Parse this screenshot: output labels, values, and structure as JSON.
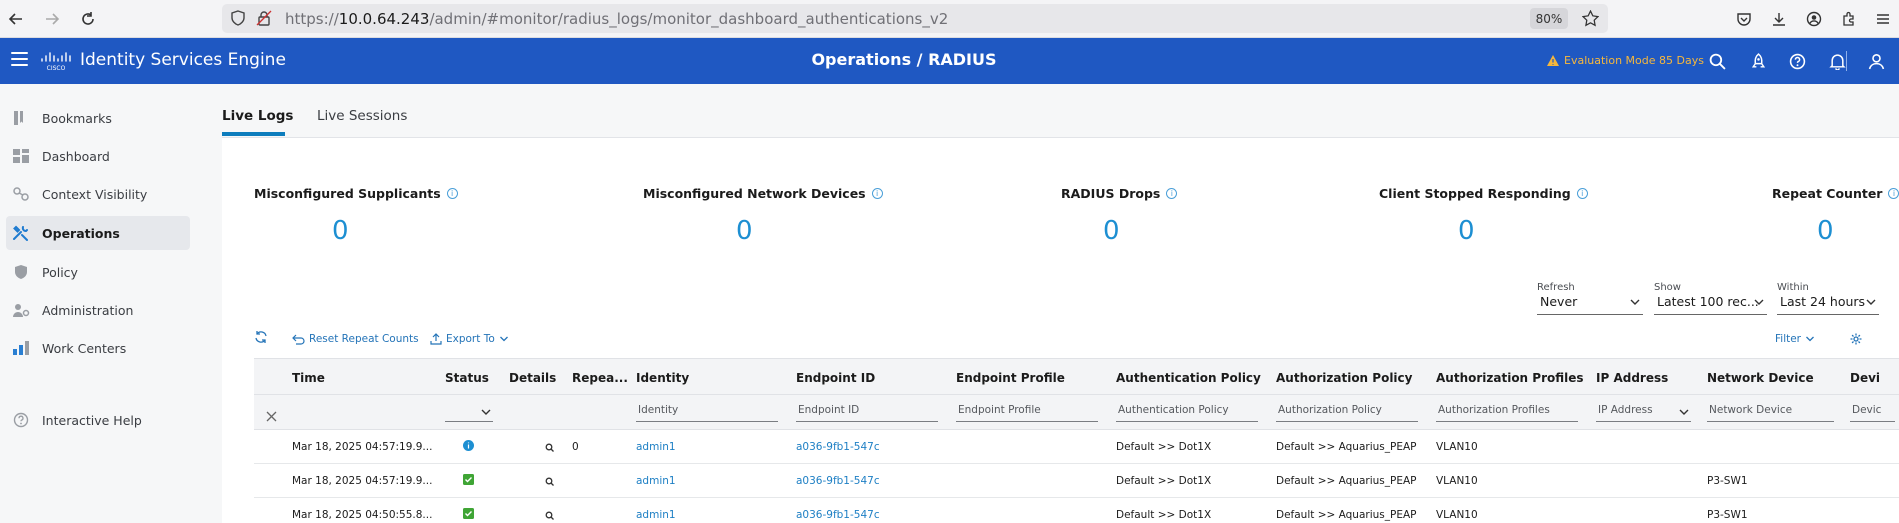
{
  "browser": {
    "url_prefix": "https://",
    "url_host": "10.0.64.243",
    "url_path": "/admin/#monitor/radius_logs/monitor_dashboard_authentications_v2",
    "zoom": "80%"
  },
  "header": {
    "app_title": "Identity Services Engine",
    "page_title": "Operations / RADIUS",
    "eval_mode": "Evaluation Mode 85 Days"
  },
  "sidebar": {
    "items": [
      {
        "label": "Bookmarks"
      },
      {
        "label": "Dashboard"
      },
      {
        "label": "Context Visibility"
      },
      {
        "label": "Operations"
      },
      {
        "label": "Policy"
      },
      {
        "label": "Administration"
      },
      {
        "label": "Work Centers"
      },
      {
        "label": "Interactive Help"
      }
    ]
  },
  "tabs": [
    {
      "label": "Live Logs"
    },
    {
      "label": "Live Sessions"
    }
  ],
  "kpis": [
    {
      "label": "Misconfigured Supplicants",
      "value": "0"
    },
    {
      "label": "Misconfigured Network Devices",
      "value": "0"
    },
    {
      "label": "RADIUS Drops",
      "value": "0"
    },
    {
      "label": "Client Stopped Responding",
      "value": "0"
    },
    {
      "label": "Repeat Counter",
      "value": "0"
    }
  ],
  "controls": {
    "refresh": {
      "label": "Refresh",
      "value": "Never"
    },
    "show": {
      "label": "Show",
      "value": "Latest 100 rec..."
    },
    "within": {
      "label": "Within",
      "value": "Last 24 hours"
    }
  },
  "toolbar": {
    "reset_label": "Reset Repeat Counts",
    "export_label": "Export To",
    "filter_label": "Filter"
  },
  "table": {
    "columns": [
      "Time",
      "Status",
      "Details",
      "Repea...",
      "Identity",
      "Endpoint ID",
      "Endpoint Profile",
      "Authentication Policy",
      "Authorization Policy",
      "Authorization Profiles",
      "IP Address",
      "Network Device",
      "Devi"
    ],
    "filters": [
      "Identity",
      "Endpoint ID",
      "Endpoint Profile",
      "Authentication Policy",
      "Authorization Policy",
      "Authorization Profiles",
      "IP Address",
      "Network Device",
      "Devic"
    ],
    "rows": [
      {
        "time": "Mar 18, 2025 04:57:19.9...",
        "status": "info",
        "repeat": "0",
        "identity": "admin1",
        "endpoint": "a036-9fb1-547c",
        "authn": "Default >> Dot1X",
        "authz": "Default >> Aquarius_PEAP",
        "profile": "VLAN10",
        "device": ""
      },
      {
        "time": "Mar 18, 2025 04:57:19.9...",
        "status": "success",
        "repeat": "",
        "identity": "admin1",
        "endpoint": "a036-9fb1-547c",
        "authn": "Default >> Dot1X",
        "authz": "Default >> Aquarius_PEAP",
        "profile": "VLAN10",
        "device": "P3-SW1"
      },
      {
        "time": "Mar 18, 2025 04:50:55.8...",
        "status": "success",
        "repeat": "",
        "identity": "admin1",
        "endpoint": "a036-9fb1-547c",
        "authn": "Default >> Dot1X",
        "authz": "Default >> Aquarius_PEAP",
        "profile": "VLAN10",
        "device": "P3-SW1"
      }
    ]
  },
  "colors": {
    "header_bg": "#1f58c2",
    "accent": "#1d8fd2",
    "link": "#1d7fc4",
    "eval_warning": "#f6b73c",
    "success": "#3fa535"
  }
}
